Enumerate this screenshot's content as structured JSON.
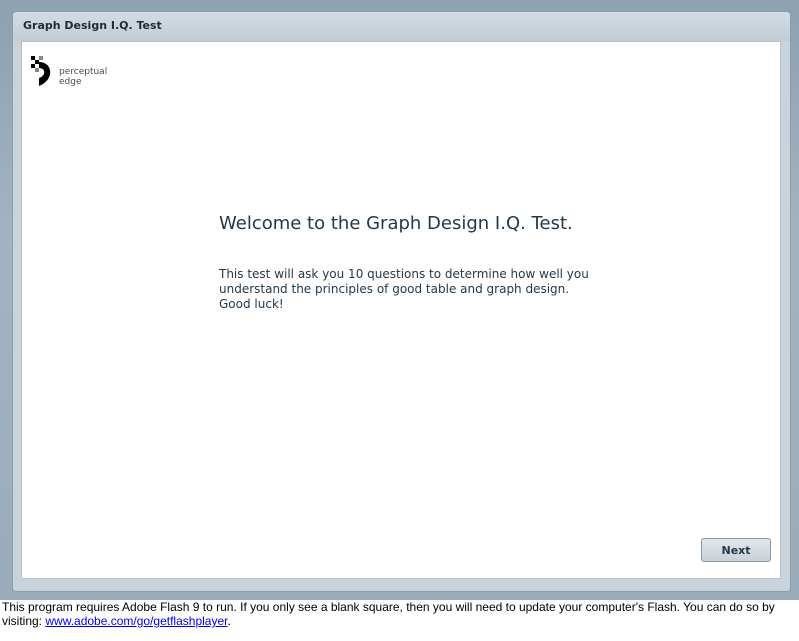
{
  "app": {
    "title": "Graph Design I.Q. Test"
  },
  "logo": {
    "line1": "perceptual",
    "line2": "edge"
  },
  "main": {
    "heading": "Welcome to the Graph Design I.Q. Test.",
    "intro": "This test will ask you 10 questions to determine how well you understand the principles of good table and graph design. Good luck!"
  },
  "buttons": {
    "next_label": "Next"
  },
  "footer": {
    "text": "This program requires Adobe Flash 9 to run. If you only see a blank square, then you will need to update your computer's Flash. You can do so by visiting: ",
    "link_text": "www.adobe.com/go/getflashplayer",
    "trailing": "."
  },
  "colors": {
    "heading_text": "#22394a",
    "link": "#0000ee"
  }
}
